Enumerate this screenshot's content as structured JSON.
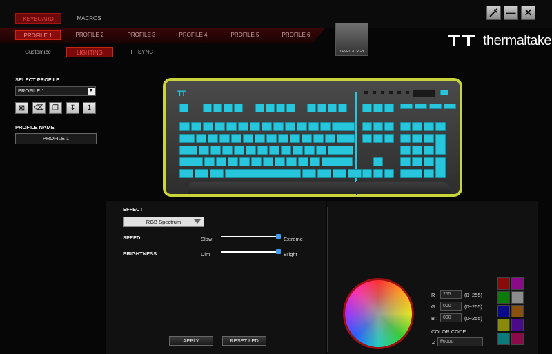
{
  "top_tabs": {
    "keyboard": "KEYBOARD",
    "macros": "MACROS"
  },
  "profile_tabs": [
    "PROFILE 1",
    "PROFILE 2",
    "PROFILE 3",
    "PROFILE 4",
    "PROFILE 5",
    "PROFILE 6"
  ],
  "sub_tabs": {
    "customize": "Customize",
    "lighting": "LIGHTING",
    "tt_sync": "TT SYNC"
  },
  "window_buttons": {
    "settings": "settings-icon",
    "minimize": "minimize-icon",
    "close": "close-icon"
  },
  "device_thumbnail": {
    "label": "LEVEL 20 RGB"
  },
  "brand": {
    "name": "thermaltake",
    "accent": "#27c6dd",
    "frame": "#c8d43a",
    "red": "#a01010"
  },
  "left_panel": {
    "select_profile_label": "SELECT PROFILE",
    "selected_profile": "PROFILE 1",
    "actions": [
      "save-icon",
      "delete-icon",
      "copy-icon",
      "import-icon",
      "export-icon"
    ],
    "profile_name_label": "PROFILE NAME",
    "profile_name_value": "PROFILE 1"
  },
  "effect": {
    "label": "EFFECT",
    "selected": "RGB Spectrum",
    "speed": {
      "label": "SPEED",
      "min_label": "Slow",
      "max_label": "Extreme",
      "value_fraction": 1.0
    },
    "brightness": {
      "label": "BRIGHTNESS",
      "min_label": "Dim",
      "max_label": "Bright",
      "value_fraction": 1.0
    },
    "apply_label": "APPLY",
    "reset_label": "RESET LED"
  },
  "color": {
    "r_label": "R :",
    "r_value": "255",
    "r_range": "(0~255)",
    "g_label": "G :",
    "g_value": "000",
    "g_range": "(0~255)",
    "b_label": "B :",
    "b_value": "000",
    "b_range": "(0~255)",
    "code_label": "COLOR CODE :",
    "hash": "#",
    "code_value": "ff0000",
    "swatches": [
      "#8a0a0a",
      "#8a0a8a",
      "#0a7a0a",
      "#8c8c8c",
      "#0a0a8a",
      "#8a5010",
      "#8a8a0a",
      "#4a0a8a",
      "#0a7a7a",
      "#8a0a4a"
    ]
  }
}
